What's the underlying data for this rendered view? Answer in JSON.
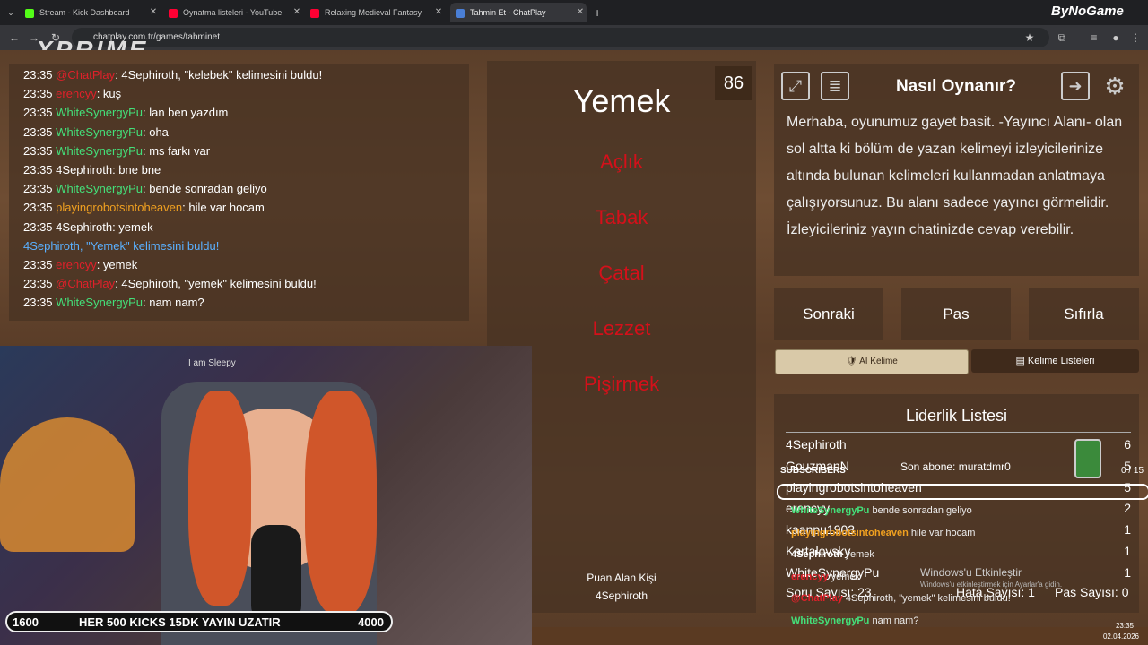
{
  "browser": {
    "tabs": [
      {
        "title": "Stream - Kick Dashboard",
        "color": "#53fc18"
      },
      {
        "title": "Oynatma listeleri - YouTube",
        "color": "#ff0033"
      },
      {
        "title": "Relaxing Medieval Fantasy",
        "color": "#ff0033"
      },
      {
        "title": "Tahmin Et - ChatPlay",
        "color": "#4a7fd6"
      }
    ],
    "url": "chatplay.com.tr/games/tahminet",
    "overlay_brand": "ByNoGame"
  },
  "stream_logo": "XPRIME",
  "chat": {
    "lines": [
      {
        "time": "23:35",
        "user": "@ChatPlay",
        "user_color": "#e0202a",
        "text": ": 4Sephiroth, \"kelebek\" kelimesini buldu!"
      },
      {
        "time": "23:35",
        "user": "erencyy",
        "user_color": "#e0202a",
        "text": ": kuş"
      },
      {
        "time": "23:35",
        "user": "WhiteSynergyPu",
        "user_color": "#44e07a",
        "text": ": lan ben yazdım"
      },
      {
        "time": "23:35",
        "user": "WhiteSynergyPu",
        "user_color": "#44e07a",
        "text": ": oha"
      },
      {
        "time": "23:35",
        "user": "WhiteSynergyPu",
        "user_color": "#44e07a",
        "text": ": ms farkı var"
      },
      {
        "time": "23:35",
        "user": "4Sephiroth",
        "user_color": "#ffffff",
        "text": ": bne bne"
      },
      {
        "time": "23:35",
        "user": "WhiteSynergyPu",
        "user_color": "#44e07a",
        "text": ": bende sonradan geliyo"
      },
      {
        "time": "23:35",
        "user": "playingrobotsintoheaven",
        "user_color": "#f0a020",
        "text": ": hile var hocam"
      },
      {
        "time": "23:35",
        "user": "4Sephiroth",
        "user_color": "#ffffff",
        "text": ": yemek"
      },
      {
        "time": "",
        "user": "4Sephiroth, \"Yemek\" kelimesini buldu!",
        "user_color": "#5ab0ff",
        "text": ""
      },
      {
        "time": "23:35",
        "user": "erencyy",
        "user_color": "#e0202a",
        "text": ": yemek"
      },
      {
        "time": "23:35",
        "user": "@ChatPlay",
        "user_color": "#e0202a",
        "text": ": 4Sephiroth, \"yemek\" kelimesini buldu!"
      },
      {
        "time": "23:35",
        "user": "WhiteSynergyPu",
        "user_color": "#44e07a",
        "text": ": nam nam?"
      }
    ]
  },
  "game": {
    "word": "Yemek",
    "timer": "86",
    "forbidden": [
      "Açlık",
      "Tabak",
      "Çatal",
      "Lezzet",
      "Pişirmek"
    ],
    "scorer_label": "Puan Alan Kişi",
    "scorer_name": "4Sephiroth"
  },
  "howto": {
    "title": "Nasıl Oynanır?",
    "text": "Merhaba, oyunumuz gayet basit. -Yayıncı Alanı- olan sol altta ki bölüm de yazan kelimeyi izleyicilerinize altında bulunan kelimeleri kullanmadan anlatmaya çalışıyorsunuz. Bu alanı sadece yayıncı görmelidir. İzleyicileriniz yayın chatinizde cevap verebilir."
  },
  "controls": {
    "next": "Sonraki",
    "pass": "Pas",
    "reset": "Sıfırla",
    "ai_word": "AI Kelime",
    "word_lists": "Kelime Listeleri"
  },
  "leaderboard": {
    "title": "Liderlik Listesi",
    "rows": [
      {
        "name": "4Sephiroth",
        "score": "6"
      },
      {
        "name": "GouzmanN",
        "score": "5"
      },
      {
        "name": "playingrobotsintoheaven",
        "score": "5"
      },
      {
        "name": "erencyy",
        "score": "2"
      },
      {
        "name": "kaanpu1903",
        "score": "1"
      },
      {
        "name": "Kartalovsky",
        "score": "1"
      },
      {
        "name": "WhiteSynergyPu",
        "score": "1"
      }
    ],
    "question_count": "Soru Sayısı: 23",
    "error_count": "Hata Sayısı: 1",
    "pass_count": "Pas Sayısı: 0"
  },
  "stream_overlay": {
    "subscribers_label": "SUBSCRIBERS",
    "last_sub": "Son abone: muratdmr0",
    "goal": "0 / 15",
    "kicks_left": "1600",
    "kicks_text": "HER 500 KICKS 15DK YAYIN UZATIR",
    "kicks_right": "4000",
    "cam_sign": "I am Sleepy",
    "windows_activate": "Windows'u Etkinleştir",
    "windows_sub": "Windows'u etkinleştirmek için Ayarlar'a gidin.",
    "overlay_chat": [
      {
        "user": "WhiteSynergyPu",
        "color": "#44e07a",
        "text": "bende sonradan geliyo"
      },
      {
        "user": "playingrobotsintoheaven",
        "color": "#f0a020",
        "text": "hile var hocam"
      },
      {
        "user": "4Sephiroth",
        "color": "#ffffff",
        "text": "yemek"
      },
      {
        "user": "erencyy",
        "color": "#e0202a",
        "text": "yemek"
      },
      {
        "user": "@ChatPlay",
        "color": "#e0202a",
        "text": "4Sephiroth, \"yemek\" kelimesini buldu!"
      },
      {
        "user": "WhiteSynergyPu",
        "color": "#44e07a",
        "text": "nam nam?"
      }
    ]
  },
  "taskbar": {
    "time": "23:35",
    "date": "02.04.2026"
  }
}
